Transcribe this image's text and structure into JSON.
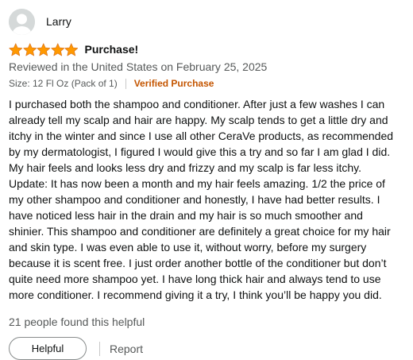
{
  "reviewer": {
    "name": "Larry",
    "avatar_icon": "default-user-avatar-icon"
  },
  "rating": {
    "stars": 5,
    "max_stars": 5,
    "star_color": "#ff9900",
    "icon": "star-icon"
  },
  "review": {
    "title": "Purchase!",
    "date_line": "Reviewed in the United States on February 25, 2025",
    "size_label": "Size: 12 Fl Oz (Pack of 1)",
    "verified_label": "Verified Purchase",
    "body_lines": [
      "I purchased both the shampoo and conditioner. After just a few washes I can",
      "already tell my scalp and hair are happy. My scalp tends to get a little dry and",
      "itchy in the winter and since I use all other CeraVe products, as recommended",
      "by my dermatologist, I figured I would give this a try and so far I am glad I did.",
      "My hair feels and looks less dry and frizzy and my scalp is far less itchy.",
      "Update: It has now been a month and my hair feels amazing. 1/2 the price of",
      "my other shampoo and conditioner and honestly, I have had better results. I",
      "have noticed less hair in the drain and my hair is so much smoother and",
      "shinier. This shampoo and conditioner are definitely a great choice for my hair",
      "and skin type. I was even able to use it, without worry, before my surgery",
      "because it is scent free. I just order another bottle of the conditioner but don’t",
      "quite need more shampoo yet. I have long thick hair and always tend to use",
      "more conditioner. I recommend giving it a try, I think you’ll be happy you did."
    ]
  },
  "helpful_count_text": "21 people found this helpful",
  "actions": {
    "helpful_label": "Helpful",
    "report_label": "Report"
  },
  "colors": {
    "verified": "#c45500",
    "secondary_text": "#565959"
  }
}
